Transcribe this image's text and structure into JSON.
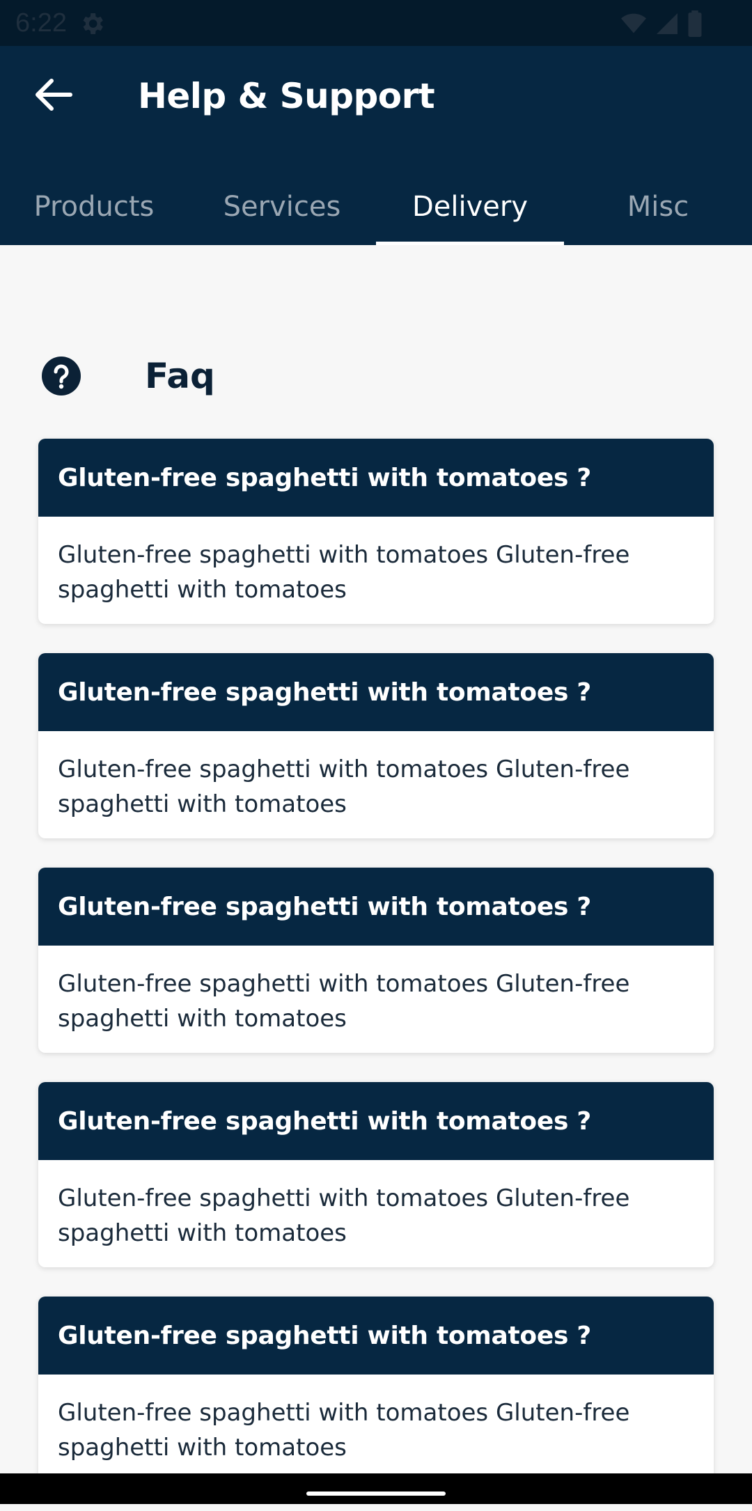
{
  "status_bar": {
    "time": "6:22",
    "icons": [
      "gear-icon",
      "wifi-icon",
      "signal-icon",
      "battery-icon"
    ]
  },
  "app_bar": {
    "title": "Help & Support",
    "back_icon": "arrow-left-icon"
  },
  "tabs": [
    {
      "label": "Products",
      "active": false
    },
    {
      "label": "Services",
      "active": false
    },
    {
      "label": "Delivery",
      "active": true
    },
    {
      "label": "Misc",
      "active": false
    }
  ],
  "faq": {
    "title": "Faq",
    "icon": "help-circle-icon",
    "items": [
      {
        "question": "Gluten-free spaghetti with tomatoes ?",
        "answer": "Gluten-free spaghetti with tomatoes Gluten-free spaghetti with tomatoes"
      },
      {
        "question": "Gluten-free spaghetti with tomatoes ?",
        "answer": "Gluten-free spaghetti with tomatoes Gluten-free spaghetti with tomatoes"
      },
      {
        "question": "Gluten-free spaghetti with tomatoes ?",
        "answer": "Gluten-free spaghetti with tomatoes Gluten-free spaghetti with tomatoes"
      },
      {
        "question": "Gluten-free spaghetti with tomatoes ?",
        "answer": "Gluten-free spaghetti with tomatoes Gluten-free spaghetti with tomatoes"
      },
      {
        "question": "Gluten-free spaghetti with tomatoes ?",
        "answer": "Gluten-free spaghetti with tomatoes Gluten-free spaghetti with tomatoes"
      }
    ]
  },
  "colors": {
    "primary": "#062742",
    "status_bar": "#041a2b",
    "background": "#f7f7f7",
    "tab_inactive": "#9aa7b3",
    "tab_active": "#ffffff"
  }
}
